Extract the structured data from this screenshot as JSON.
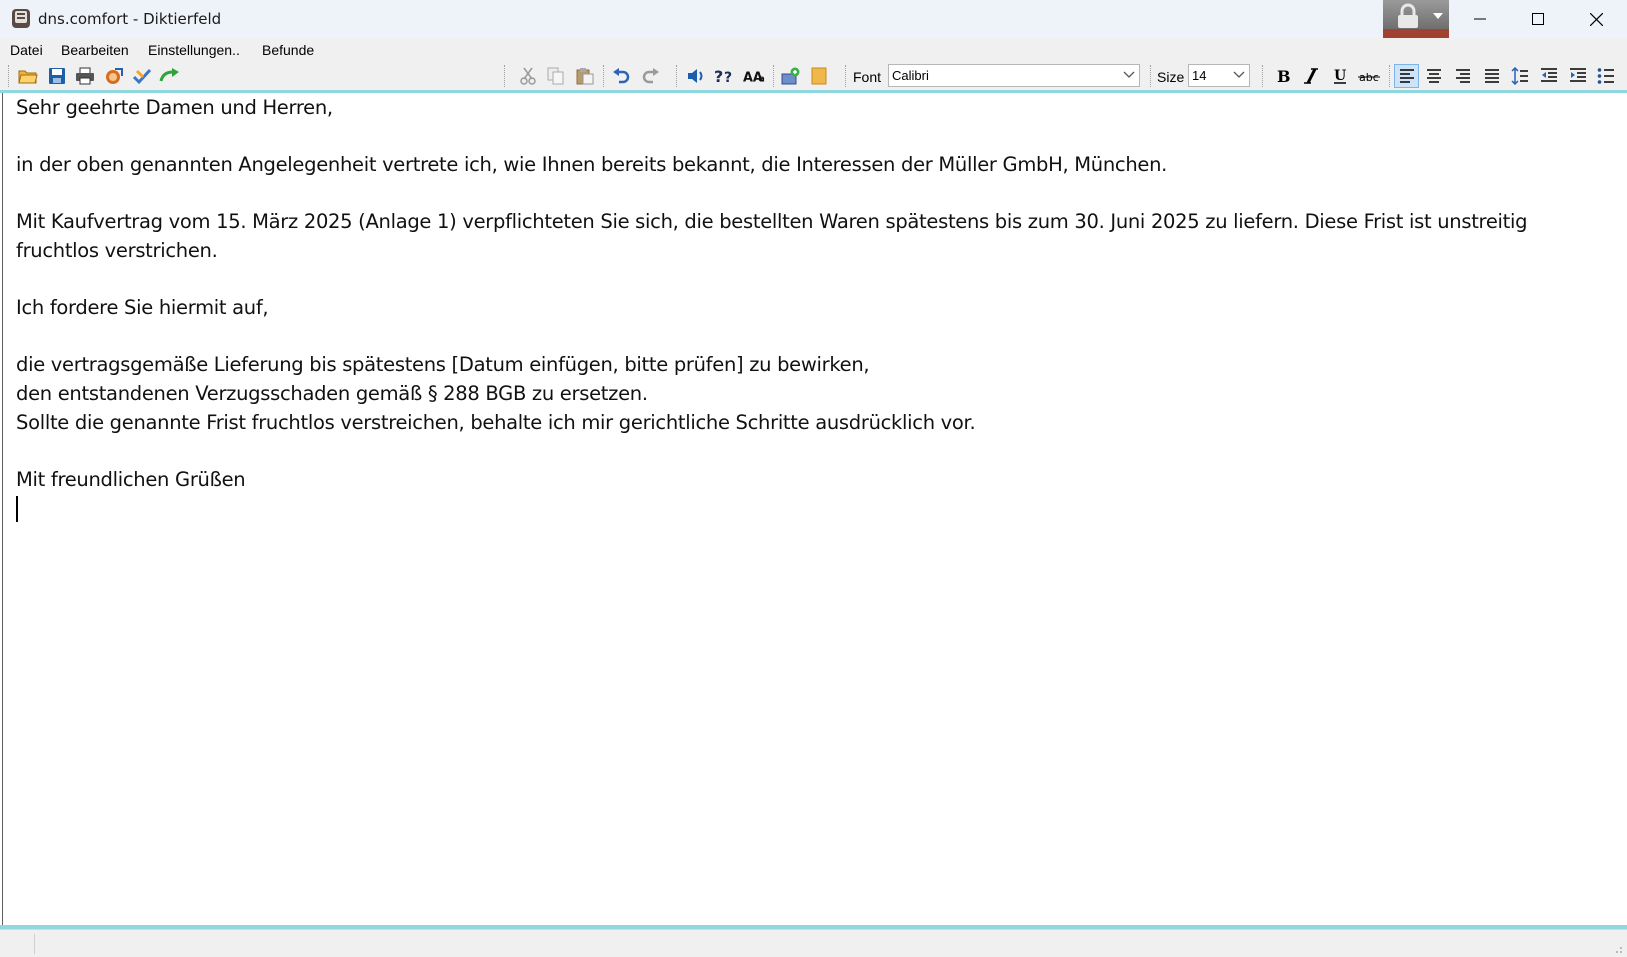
{
  "window": {
    "title": "dns.comfort - Diktierfeld"
  },
  "menu": {
    "items": [
      {
        "label": "Datei"
      },
      {
        "label": "Bearbeiten"
      },
      {
        "label": "Einstellungen.."
      },
      {
        "label": "Befunde"
      }
    ]
  },
  "toolbar": {
    "font_label": "Font",
    "font_value": "Calibri",
    "size_label": "Size",
    "size_value": "14",
    "icons": [
      "open-folder-icon",
      "save-icon",
      "print-icon",
      "export-icon",
      "check-icon",
      "forward-arrow-icon",
      "cut-icon",
      "copy-icon",
      "paste-icon",
      "undo-icon",
      "redo-icon",
      "speaker-icon",
      "help-icon",
      "text-case-icon",
      "insert-template-icon",
      "notes-icon",
      "bold-icon",
      "italic-icon",
      "underline-icon",
      "strikethrough-icon",
      "align-left-icon",
      "align-center-icon",
      "align-right-icon",
      "justify-icon",
      "line-spacing-icon",
      "outdent-icon",
      "indent-icon",
      "bullet-list-icon"
    ],
    "active_alignment": "left"
  },
  "document": {
    "lines": [
      "Sehr geehrte Damen und Herren,",
      "",
      "in der oben genannten Angelegenheit vertrete ich, wie Ihnen bereits bekannt, die Interessen der Müller GmbH, München.",
      "",
      "Mit Kaufvertrag vom 15. März 2025 (Anlage 1) verpflichteten Sie sich, die bestellten Waren spätestens bis zum 30. Juni 2025 zu liefern. Diese Frist ist unstreitig",
      "fruchtlos verstrichen.",
      "",
      "Ich fordere Sie hiermit auf,",
      "",
      "die vertragsgemäße Lieferung bis spätestens [Datum einfügen, bitte prüfen] zu bewirken,",
      "den entstandenen Verzugsschaden gemäß § 288 BGB zu ersetzen.",
      "Sollte die genannte Frist fruchtlos verstreichen, behalte ich mir gerichtliche Schritte ausdrücklich vor.",
      "",
      "Mit freundlichen Grüßen"
    ]
  },
  "colors": {
    "accent_line": "#8fd8e0",
    "lock_button": "#a14231"
  }
}
